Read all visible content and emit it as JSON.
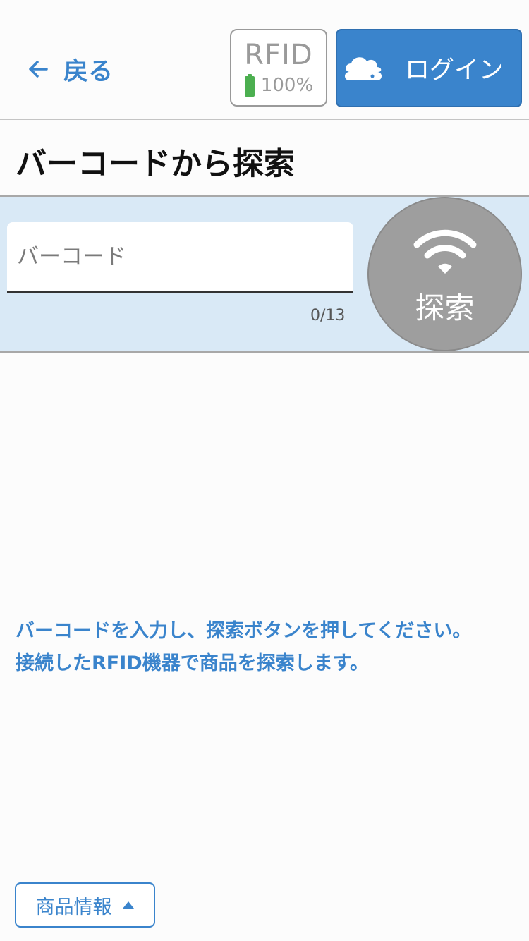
{
  "header": {
    "back_label": "戻る",
    "rfid": {
      "label": "RFID",
      "battery_text": "100%",
      "battery_color": "#4caf50"
    },
    "login_label": "ログイン"
  },
  "page_title": "バーコードから探索",
  "search": {
    "placeholder": "バーコード",
    "value": "",
    "counter": "0/13",
    "button_label": "探索"
  },
  "instructions": {
    "line1": "バーコードを入力し、探索ボタンを押してください。",
    "line2": "接続したRFID機器で商品を探索します。"
  },
  "footer": {
    "product_info_label": "商品情報"
  },
  "icons": {
    "back": "arrow-left-icon",
    "battery": "battery-full-icon",
    "login": "cloud-icon",
    "search": "wifi-signal-icon",
    "toggle": "triangle-up-icon"
  },
  "colors": {
    "accent": "#3a84cc",
    "search_band": "#d9e9f6",
    "search_button": "#9e9e9e"
  }
}
